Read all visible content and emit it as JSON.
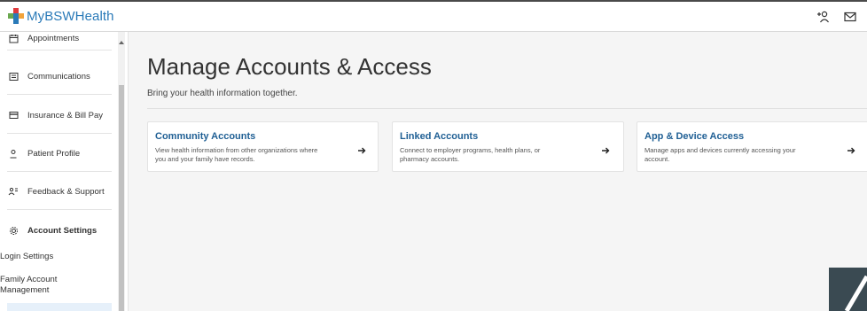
{
  "app": {
    "title": "MyBSWHealth"
  },
  "header": {
    "icons": [
      "add-person-icon",
      "mail-icon"
    ]
  },
  "sidebar": {
    "items": [
      {
        "label": "Appointments",
        "icon": "calendar-icon"
      },
      {
        "label": "Communications",
        "icon": "message-icon"
      },
      {
        "label": "Insurance & Bill Pay",
        "icon": "card-icon"
      },
      {
        "label": "Patient Profile",
        "icon": "person-icon"
      },
      {
        "label": "Feedback & Support",
        "icon": "feedback-icon"
      },
      {
        "label": "Account Settings",
        "icon": "gear-icon"
      }
    ],
    "sub_items": [
      {
        "label": "Login Settings"
      },
      {
        "label": "Family Account Management"
      }
    ]
  },
  "main": {
    "title": "Manage Accounts & Access",
    "subtitle": "Bring your health information together.",
    "cards": [
      {
        "title": "Community Accounts",
        "desc_line1": "View health information from other organizations where",
        "desc_line2": "you and your family have records."
      },
      {
        "title": "Linked Accounts",
        "desc_line1": "Connect to employer programs, health plans, or",
        "desc_line2": "pharmacy accounts."
      },
      {
        "title": "App & Device Access",
        "desc_line1": "Manage apps and devices currently accessing your",
        "desc_line2": "account."
      }
    ]
  },
  "colors": {
    "brand_blue": "#2a7ab8",
    "card_title": "#1f5f94",
    "logo_red": "#e03a3e",
    "logo_green": "#6aa84f"
  }
}
